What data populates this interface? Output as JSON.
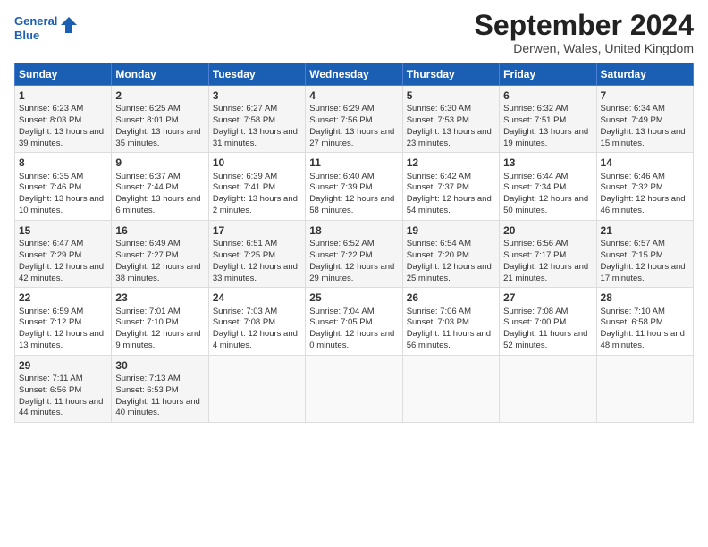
{
  "header": {
    "logo_line1": "General",
    "logo_line2": "Blue",
    "title": "September 2024",
    "location": "Derwen, Wales, United Kingdom"
  },
  "weekdays": [
    "Sunday",
    "Monday",
    "Tuesday",
    "Wednesday",
    "Thursday",
    "Friday",
    "Saturday"
  ],
  "rows": [
    [
      {
        "day": "1",
        "sunrise": "6:23 AM",
        "sunset": "8:03 PM",
        "daylight": "13 hours and 39 minutes."
      },
      {
        "day": "2",
        "sunrise": "6:25 AM",
        "sunset": "8:01 PM",
        "daylight": "13 hours and 35 minutes."
      },
      {
        "day": "3",
        "sunrise": "6:27 AM",
        "sunset": "7:58 PM",
        "daylight": "13 hours and 31 minutes."
      },
      {
        "day": "4",
        "sunrise": "6:29 AM",
        "sunset": "7:56 PM",
        "daylight": "13 hours and 27 minutes."
      },
      {
        "day": "5",
        "sunrise": "6:30 AM",
        "sunset": "7:53 PM",
        "daylight": "13 hours and 23 minutes."
      },
      {
        "day": "6",
        "sunrise": "6:32 AM",
        "sunset": "7:51 PM",
        "daylight": "13 hours and 19 minutes."
      },
      {
        "day": "7",
        "sunrise": "6:34 AM",
        "sunset": "7:49 PM",
        "daylight": "13 hours and 15 minutes."
      }
    ],
    [
      {
        "day": "8",
        "sunrise": "6:35 AM",
        "sunset": "7:46 PM",
        "daylight": "13 hours and 10 minutes."
      },
      {
        "day": "9",
        "sunrise": "6:37 AM",
        "sunset": "7:44 PM",
        "daylight": "13 hours and 6 minutes."
      },
      {
        "day": "10",
        "sunrise": "6:39 AM",
        "sunset": "7:41 PM",
        "daylight": "13 hours and 2 minutes."
      },
      {
        "day": "11",
        "sunrise": "6:40 AM",
        "sunset": "7:39 PM",
        "daylight": "12 hours and 58 minutes."
      },
      {
        "day": "12",
        "sunrise": "6:42 AM",
        "sunset": "7:37 PM",
        "daylight": "12 hours and 54 minutes."
      },
      {
        "day": "13",
        "sunrise": "6:44 AM",
        "sunset": "7:34 PM",
        "daylight": "12 hours and 50 minutes."
      },
      {
        "day": "14",
        "sunrise": "6:46 AM",
        "sunset": "7:32 PM",
        "daylight": "12 hours and 46 minutes."
      }
    ],
    [
      {
        "day": "15",
        "sunrise": "6:47 AM",
        "sunset": "7:29 PM",
        "daylight": "12 hours and 42 minutes."
      },
      {
        "day": "16",
        "sunrise": "6:49 AM",
        "sunset": "7:27 PM",
        "daylight": "12 hours and 38 minutes."
      },
      {
        "day": "17",
        "sunrise": "6:51 AM",
        "sunset": "7:25 PM",
        "daylight": "12 hours and 33 minutes."
      },
      {
        "day": "18",
        "sunrise": "6:52 AM",
        "sunset": "7:22 PM",
        "daylight": "12 hours and 29 minutes."
      },
      {
        "day": "19",
        "sunrise": "6:54 AM",
        "sunset": "7:20 PM",
        "daylight": "12 hours and 25 minutes."
      },
      {
        "day": "20",
        "sunrise": "6:56 AM",
        "sunset": "7:17 PM",
        "daylight": "12 hours and 21 minutes."
      },
      {
        "day": "21",
        "sunrise": "6:57 AM",
        "sunset": "7:15 PM",
        "daylight": "12 hours and 17 minutes."
      }
    ],
    [
      {
        "day": "22",
        "sunrise": "6:59 AM",
        "sunset": "7:12 PM",
        "daylight": "12 hours and 13 minutes."
      },
      {
        "day": "23",
        "sunrise": "7:01 AM",
        "sunset": "7:10 PM",
        "daylight": "12 hours and 9 minutes."
      },
      {
        "day": "24",
        "sunrise": "7:03 AM",
        "sunset": "7:08 PM",
        "daylight": "12 hours and 4 minutes."
      },
      {
        "day": "25",
        "sunrise": "7:04 AM",
        "sunset": "7:05 PM",
        "daylight": "12 hours and 0 minutes."
      },
      {
        "day": "26",
        "sunrise": "7:06 AM",
        "sunset": "7:03 PM",
        "daylight": "11 hours and 56 minutes."
      },
      {
        "day": "27",
        "sunrise": "7:08 AM",
        "sunset": "7:00 PM",
        "daylight": "11 hours and 52 minutes."
      },
      {
        "day": "28",
        "sunrise": "7:10 AM",
        "sunset": "6:58 PM",
        "daylight": "11 hours and 48 minutes."
      }
    ],
    [
      {
        "day": "29",
        "sunrise": "7:11 AM",
        "sunset": "6:56 PM",
        "daylight": "11 hours and 44 minutes."
      },
      {
        "day": "30",
        "sunrise": "7:13 AM",
        "sunset": "6:53 PM",
        "daylight": "11 hours and 40 minutes."
      },
      null,
      null,
      null,
      null,
      null
    ]
  ]
}
